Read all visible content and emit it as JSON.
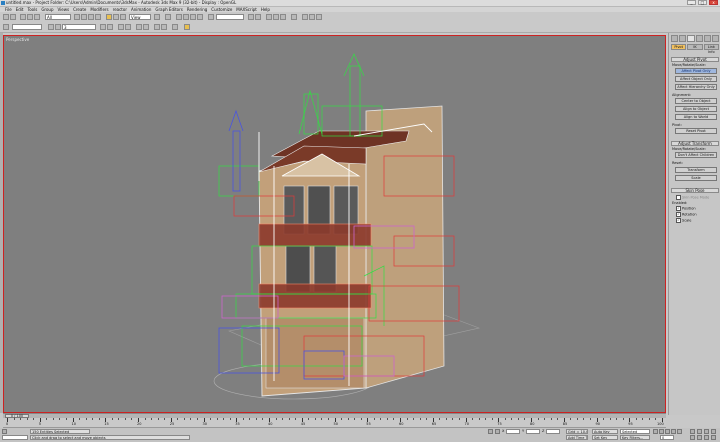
{
  "window": {
    "title": "untitled.max - Project Folder: C:\\Users\\Admin\\Documents\\3dsMax - Autodesk 3ds Max 9 (32-bit) - Display : OpenGL",
    "minimize": "_",
    "maximize": "□",
    "close": "x"
  },
  "menu": [
    "File",
    "Edit",
    "Tools",
    "Group",
    "Views",
    "Create",
    "Modifiers",
    "reactor",
    "Animation",
    "Graph Editors",
    "Rendering",
    "Customize",
    "MAXScript",
    "Help"
  ],
  "toolbar": {
    "selection_filter": "All",
    "reference_coord": "View",
    "named_selection": "",
    "snap_value": "3"
  },
  "viewport": {
    "label": "Perspective",
    "colors": {
      "background": "#7f7f7f",
      "border": "#cc2222"
    }
  },
  "command_panel": {
    "tabs": [
      "create",
      "modify",
      "hierarchy",
      "motion",
      "display",
      "utilities"
    ],
    "subtabs": [
      "Pivot",
      "IK",
      "Link Info"
    ],
    "adjust_pivot": {
      "header": "Adjust Pivot",
      "group_label": "Move/Rotate/Scale:",
      "buttons": [
        "Affect Pivot Only",
        "Affect Object Only",
        "Affect Hierarchy Only"
      ]
    },
    "alignment": {
      "label": "Alignment:",
      "buttons": [
        "Center to Object",
        "Align to Object",
        "Align to World"
      ]
    },
    "pivot": {
      "label": "Pivot:",
      "button": "Reset Pivot"
    },
    "adjust_transform": {
      "header": "Adjust Transform",
      "group_label": "Move/Rotate/Scale:",
      "button": "Don't Affect Children",
      "reset_label": "Reset:",
      "buttons": [
        "Transform",
        "Scale"
      ]
    },
    "skin_pose": {
      "header": "Skin Pose",
      "checkbox_main": "Skin Pose Mode",
      "enabled_label": "Enabled:",
      "checks": [
        "Position",
        "Rotation",
        "Scale"
      ]
    }
  },
  "timeline": {
    "slider": "0 / 100",
    "ticks": [
      0,
      5,
      10,
      15,
      20,
      25,
      30,
      35,
      40,
      45,
      50,
      55,
      60,
      65,
      70,
      75,
      80,
      85,
      90,
      95,
      100
    ]
  },
  "status": {
    "selection": "150 Entities Selected",
    "prompt": "Click and drag to select and move objects",
    "x_label": "X",
    "y_label": "Y",
    "z_label": "Z",
    "grid": "Grid = 10.0",
    "add_time_tag": "Add Time Tag",
    "autokey": "Auto Key",
    "selected": "Selected",
    "set_key": "Set Key",
    "key_filters": "Key Filters...",
    "frame": "0"
  }
}
